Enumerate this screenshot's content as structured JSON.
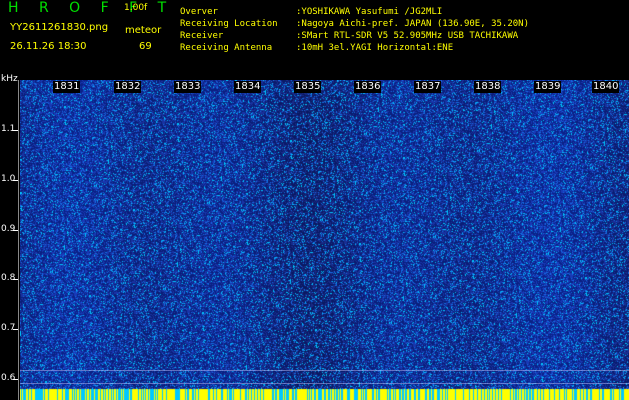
{
  "header": {
    "app_title": "H R O F F T",
    "version": "1.00f",
    "filename": "YY2611261830.png",
    "datetime": "26.11.26 18:30",
    "meteor_label": "meteor",
    "meteor_count": "69"
  },
  "info": [
    {
      "label": "Overver",
      "value": ":YOSHIKAWA Yasufumi /JG2MLI"
    },
    {
      "label": "Receiving Location",
      "value": ":Nagoya Aichi-pref. JAPAN (136.90E, 35.20N)"
    },
    {
      "label": "Receiver",
      "value": ":SMart RTL-SDR V5 52.905MHz USB TACHIKAWA"
    },
    {
      "label": "Receiving Antenna",
      "value": ":10mH 3el.YAGI Horizontal:ENE"
    }
  ],
  "axis": {
    "unit": "kHz",
    "y_ticks": [
      "1.1",
      "1.0",
      "0.9",
      "0.8",
      "0.7",
      "0.6"
    ],
    "minutes": [
      "1831",
      "1832",
      "1833",
      "1834",
      "1835",
      "1836",
      "1837",
      "1838",
      "1839",
      "1840"
    ]
  },
  "colors": {
    "background": "#000000",
    "spectrogram_base": "#1a3fb8",
    "noise_cyan": "#00c8ff",
    "baseline_yellow": "#ffff00",
    "title_green": "#00e000"
  }
}
